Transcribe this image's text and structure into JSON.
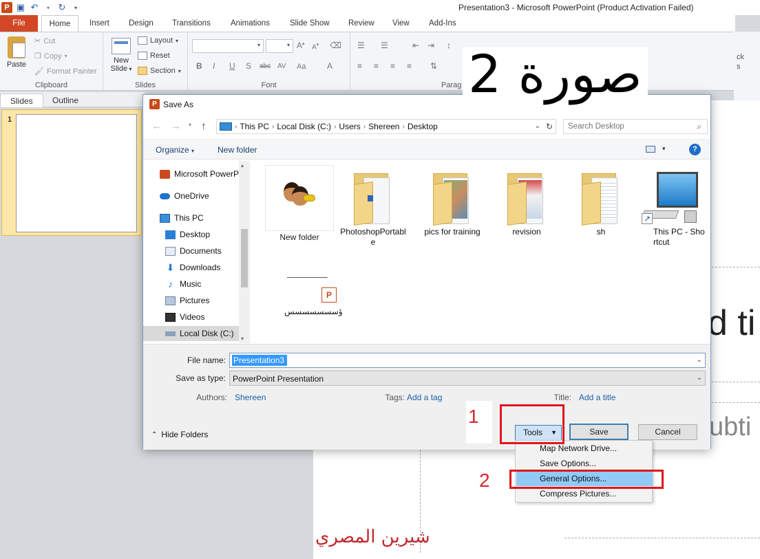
{
  "app": {
    "window_title": "Presentation3  -  Microsoft PowerPoint (Product Activation Failed)",
    "app_icon_letter": "P"
  },
  "ribbon": {
    "tabs": [
      "File",
      "Home",
      "Insert",
      "Design",
      "Transitions",
      "Animations",
      "Slide Show",
      "Review",
      "View",
      "Add-Ins"
    ],
    "clipboard": {
      "paste": "Paste",
      "cut": "Cut",
      "copy": "Copy",
      "format_painter": "Format Painter",
      "label": "Clipboard"
    },
    "slides": {
      "new_slide_line1": "New",
      "new_slide_line2": "Slide",
      "layout": "Layout",
      "reset": "Reset",
      "section": "Section",
      "label": "Slides"
    },
    "font": {
      "label": "Font",
      "bold": "B",
      "italic": "I",
      "underline": "U",
      "strike": "S",
      "abc": "abc",
      "av": "AV",
      "aa": "Aa"
    },
    "paragraph": {
      "label": "Parag"
    },
    "right_partial": {
      "line1": "ck",
      "line2": "s"
    }
  },
  "panel": {
    "tab_slides": "Slides",
    "tab_outline": "Outline",
    "slide_number": "1"
  },
  "slide": {
    "title_fragment": "d ti",
    "subtitle_fragment": "ubti"
  },
  "annotations": {
    "heading": "صورة 2",
    "step1": "1",
    "step2": "2",
    "signature": "شيرين المصري"
  },
  "dialog": {
    "title": "Save As",
    "breadcrumb": [
      "This PC",
      "Local Disk (C:)",
      "Users",
      "Shereen",
      "Desktop"
    ],
    "search_placeholder": "Search Desktop",
    "organize": "Organize",
    "new_folder": "New folder",
    "help": "?",
    "nav_items": [
      {
        "label": "Microsoft PowerP",
        "icon": "powerpoint-icon"
      },
      {
        "label": "OneDrive",
        "icon": "onedrive-icon"
      },
      {
        "label": "This PC",
        "icon": "computer-icon"
      },
      {
        "label": "Desktop",
        "icon": "desktop-icon"
      },
      {
        "label": "Documents",
        "icon": "documents-icon"
      },
      {
        "label": "Downloads",
        "icon": "downloads-icon"
      },
      {
        "label": "Music",
        "icon": "music-icon"
      },
      {
        "label": "Pictures",
        "icon": "pictures-icon"
      },
      {
        "label": "Videos",
        "icon": "videos-icon"
      },
      {
        "label": "Local Disk (C:)",
        "icon": "local-disk-icon"
      }
    ],
    "files": [
      {
        "label": "New folder",
        "kind": "folder-people"
      },
      {
        "label": "PhotoshopPortable",
        "kind": "folder"
      },
      {
        "label": "pics for training",
        "kind": "folder"
      },
      {
        "label": "revision",
        "kind": "folder"
      },
      {
        "label": "sh",
        "kind": "folder"
      },
      {
        "label": "This PC - Shortcut",
        "kind": "shortcut"
      },
      {
        "label": "ؤسسسسسسس",
        "top_text": "ــــــــــــــــــــ",
        "kind": "pptx"
      }
    ],
    "file_name_label": "File name:",
    "file_name_value": "Presentation3",
    "save_type_label": "Save as type:",
    "save_type_value": "PowerPoint Presentation",
    "authors_label": "Authors:",
    "authors_value": "Shereen",
    "tags_label": "Tags:",
    "tags_value": "Add a tag",
    "title_label": "Title:",
    "title_value": "Add a title",
    "hide_folders": "Hide Folders",
    "tools": "Tools",
    "save": "Save",
    "cancel": "Cancel",
    "tools_menu": [
      "Map Network Drive...",
      "Save Options...",
      "General Options...",
      "Compress Pictures..."
    ],
    "tools_menu_highlighted": "General Options..."
  },
  "colors": {
    "file_tab": "#d24726",
    "accent_blue": "#1e5fa8",
    "annotation_red": "#e0151b",
    "menu_highlight": "#91c9f7"
  }
}
